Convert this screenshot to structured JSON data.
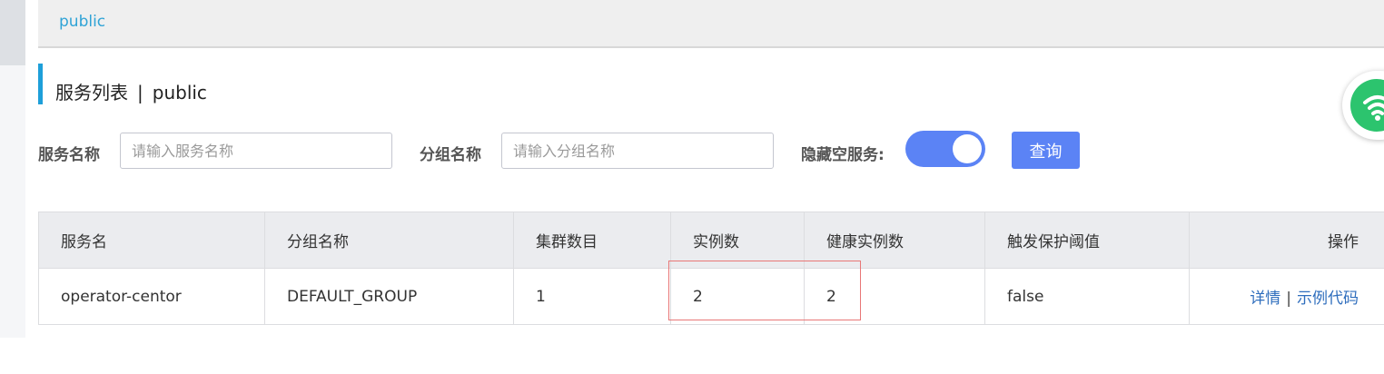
{
  "namespace_bar": {
    "current": "public"
  },
  "page": {
    "title": "服务列表",
    "separator": "|",
    "namespace": "public"
  },
  "filters": {
    "service_name_label": "服务名称",
    "service_name_placeholder": "请输入服务名称",
    "group_name_label": "分组名称",
    "group_name_placeholder": "请输入分组名称",
    "hide_empty_label": "隐藏空服务:",
    "hide_empty_enabled": true,
    "query_button": "查询"
  },
  "table": {
    "headers": [
      "服务名",
      "分组名称",
      "集群数目",
      "实例数",
      "健康实例数",
      "触发保护阈值",
      "操作"
    ],
    "rows": [
      {
        "service_name": "operator-centor",
        "group_name": "DEFAULT_GROUP",
        "cluster_count": "1",
        "instance_count": "2",
        "healthy_instance_count": "2",
        "protect_threshold": "false",
        "actions": {
          "detail": "详情",
          "sep": "|",
          "sample_code": "示例代码"
        }
      }
    ]
  },
  "colors": {
    "accent": "#5b83f5",
    "link": "#2f6ebd",
    "namespace_link": "#2fa3d6",
    "title_accent": "#1e9fd9",
    "highlight": "#e87777",
    "widget": "#2cc46e"
  },
  "icons": {
    "floating_widget": "wifi-icon"
  }
}
